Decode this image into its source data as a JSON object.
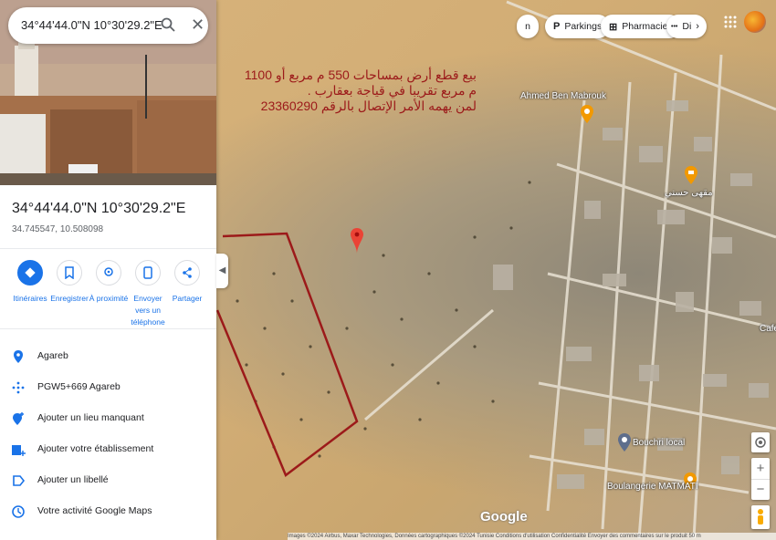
{
  "search": {
    "query": "34°44'44.0\"N 10°30'29.2\"E"
  },
  "place": {
    "title": "34°44'44.0\"N 10°30'29.2\"E",
    "decimal_coords": "34.745547, 10.508098"
  },
  "actions": [
    {
      "label": "Itinéraires",
      "icon": "directions-icon"
    },
    {
      "label": "Enregistrer",
      "icon": "bookmark-icon"
    },
    {
      "label": "À proximité",
      "icon": "nearby-icon"
    },
    {
      "label": "Envoyer vers un téléphone",
      "icon": "send-to-phone-icon"
    },
    {
      "label": "Partager",
      "icon": "share-icon"
    }
  ],
  "details": [
    {
      "text": "Agareb",
      "icon": "location-pin-icon"
    },
    {
      "text": "PGW5+669 Agareb",
      "icon": "plus-code-icon"
    },
    {
      "text": "Ajouter un lieu manquant",
      "icon": "add-place-icon"
    },
    {
      "text": "Ajouter votre établissement",
      "icon": "add-business-icon"
    },
    {
      "text": "Ajouter un libellé",
      "icon": "label-icon"
    },
    {
      "text": "Votre activité Google Maps",
      "icon": "history-icon"
    }
  ],
  "chips": [
    {
      "glyph": "P",
      "label": "Parkings"
    },
    {
      "glyph": "⊞",
      "label": "Pharmacies"
    },
    {
      "glyph": "•••",
      "label": "Di"
    }
  ],
  "overlay_text": {
    "line1": "بيع قطع أرض بمساحات 550 م مربع أو 1100 م مربع تقريبا في قياجة بعقارب .",
    "line2": "لمن يهمه الأمر الإتصال بالرقم 23360290"
  },
  "map_labels": {
    "ahmed": "Ahmed Ben Mabrouk",
    "arabic_poi": "مقهى حسني",
    "bouchri": "Bouchri local",
    "boulangerie": "Boulangerie MATMATI",
    "cafe": "Café",
    "partial_top": "n"
  },
  "footer": "Images ©2024 Airbus, Maxar Technologies, Données cartographiques ©2024     Tunisie     Conditions d'utilisation     Confidentialité     Envoyer des commentaires sur le produit     50 m",
  "google_logo": "Google",
  "colors": {
    "accent": "#1a73e8",
    "pin": "#ea4335",
    "parcel": "#9c1a1a",
    "poi": "#f29900"
  }
}
